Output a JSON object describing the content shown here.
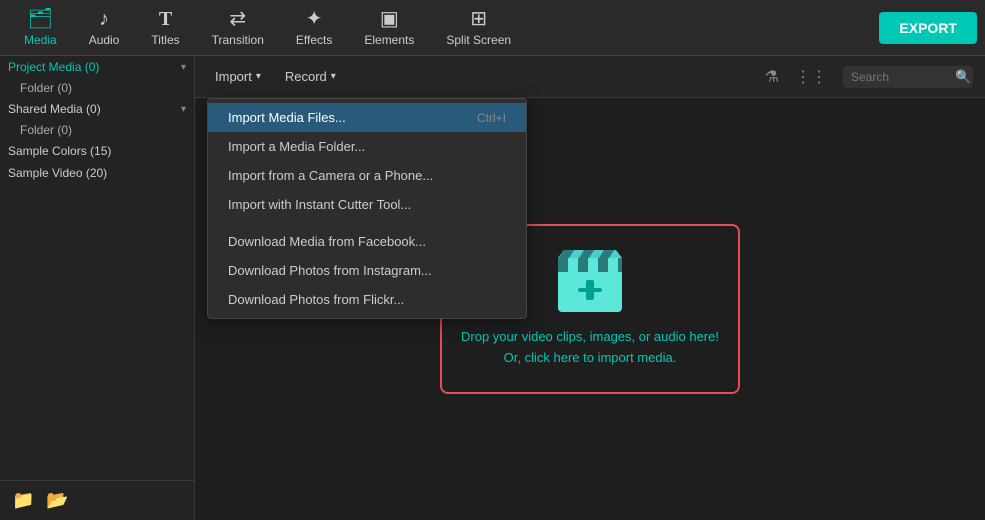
{
  "toolbar": {
    "items": [
      {
        "id": "media",
        "label": "Media",
        "icon": "🗂",
        "active": true
      },
      {
        "id": "audio",
        "label": "Audio",
        "icon": "♪",
        "active": false
      },
      {
        "id": "titles",
        "label": "Titles",
        "icon": "T",
        "active": false
      },
      {
        "id": "transition",
        "label": "Transition",
        "icon": "⇄",
        "active": false
      },
      {
        "id": "effects",
        "label": "Effects",
        "icon": "✦",
        "active": false
      },
      {
        "id": "elements",
        "label": "Elements",
        "icon": "▣",
        "active": false
      },
      {
        "id": "split-screen",
        "label": "Split Screen",
        "icon": "⊞",
        "active": false
      }
    ],
    "export_label": "EXPORT"
  },
  "sidebar": {
    "items": [
      {
        "label": "Project Media (0)",
        "active": true,
        "indent": 0,
        "has_arrow": true
      },
      {
        "label": "Folder (0)",
        "active": false,
        "indent": 1,
        "has_arrow": false
      },
      {
        "label": "Shared Media (0)",
        "active": false,
        "indent": 0,
        "has_arrow": true
      },
      {
        "label": "Folder (0)",
        "active": false,
        "indent": 1,
        "has_arrow": false
      },
      {
        "label": "Sample Colors (15)",
        "active": false,
        "indent": 0,
        "has_arrow": false
      },
      {
        "label": "Sample Video (20)",
        "active": false,
        "indent": 0,
        "has_arrow": false
      }
    ],
    "footer_icons": [
      "new-folder",
      "folder"
    ]
  },
  "import_bar": {
    "import_label": "Import",
    "record_label": "Record",
    "search_placeholder": "Search"
  },
  "dropdown": {
    "items": [
      {
        "label": "Import Media Files...",
        "shortcut": "Ctrl+I",
        "highlighted": true,
        "separator_after": false
      },
      {
        "label": "Import a Media Folder...",
        "shortcut": "",
        "highlighted": false,
        "separator_after": false
      },
      {
        "label": "Import from a Camera or a Phone...",
        "shortcut": "",
        "highlighted": false,
        "separator_after": false
      },
      {
        "label": "Import with Instant Cutter Tool...",
        "shortcut": "",
        "highlighted": false,
        "separator_after": true
      },
      {
        "label": "Download Media from Facebook...",
        "shortcut": "",
        "highlighted": false,
        "separator_after": false
      },
      {
        "label": "Download Photos from Instagram...",
        "shortcut": "",
        "highlighted": false,
        "separator_after": false
      },
      {
        "label": "Download Photos from Flickr...",
        "shortcut": "",
        "highlighted": false,
        "separator_after": false
      }
    ]
  },
  "drop_zone": {
    "text_line1": "Drop your video clips, images, or audio here!",
    "text_line2": "Or, click here to import media."
  }
}
